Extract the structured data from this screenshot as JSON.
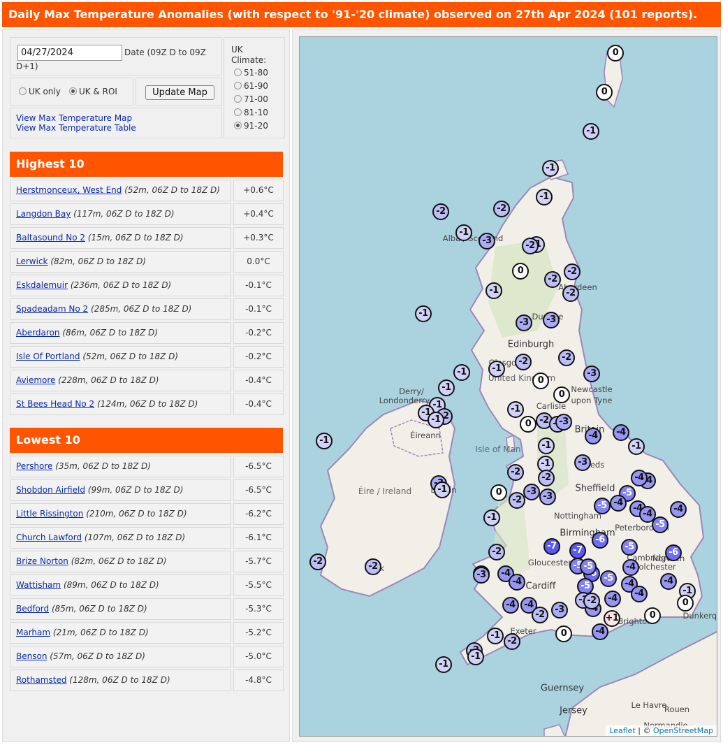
{
  "header": {
    "title": "Daily Max Temperature Anomalies (with respect to '91-'20 climate) observed on 27th Apr 2024 (101 reports)."
  },
  "controls": {
    "date_value": "04/27/2024",
    "date_label_a": "Date (09Z D to 09Z",
    "date_label_b": "D+1)",
    "region_options": [
      {
        "label": "UK only",
        "selected": false
      },
      {
        "label": "UK & ROI",
        "selected": true
      }
    ],
    "update_button": "Update Map",
    "links": [
      "View Max Temperature Map",
      "View Max Temperature Table"
    ],
    "climate_title": "UK Climate:",
    "climate_options": [
      {
        "label": "51-80",
        "selected": false
      },
      {
        "label": "61-90",
        "selected": false
      },
      {
        "label": "71-00",
        "selected": false
      },
      {
        "label": "81-10",
        "selected": false
      },
      {
        "label": "91-20",
        "selected": true
      }
    ]
  },
  "highest": {
    "title": "Highest 10",
    "rows": [
      {
        "station": "Herstmonceux, West End",
        "detail": "(52m, 06Z D to 18Z D)",
        "value": "+0.6°C"
      },
      {
        "station": "Langdon Bay",
        "detail": "(117m, 06Z D to 18Z D)",
        "value": "+0.4°C"
      },
      {
        "station": "Baltasound No 2",
        "detail": "(15m, 06Z D to 18Z D)",
        "value": "+0.3°C"
      },
      {
        "station": "Lerwick",
        "detail": "(82m, 06Z D to 18Z D)",
        "value": "0.0°C"
      },
      {
        "station": "Eskdalemuir",
        "detail": "(236m, 06Z D to 18Z D)",
        "value": "-0.1°C"
      },
      {
        "station": "Spadeadam No 2",
        "detail": "(285m, 06Z D to 18Z D)",
        "value": "-0.1°C"
      },
      {
        "station": "Aberdaron",
        "detail": "(86m, 06Z D to 18Z D)",
        "value": "-0.2°C"
      },
      {
        "station": "Isle Of Portland",
        "detail": "(52m, 06Z D to 18Z D)",
        "value": "-0.2°C"
      },
      {
        "station": "Aviemore",
        "detail": "(228m, 06Z D to 18Z D)",
        "value": "-0.4°C"
      },
      {
        "station": "St Bees Head No 2",
        "detail": "(124m, 06Z D to 18Z D)",
        "value": "-0.4°C"
      }
    ]
  },
  "lowest": {
    "title": "Lowest 10",
    "rows": [
      {
        "station": "Pershore",
        "detail": "(35m, 06Z D to 18Z D)",
        "value": "-6.5°C"
      },
      {
        "station": "Shobdon Airfield",
        "detail": "(99m, 06Z D to 18Z D)",
        "value": "-6.5°C"
      },
      {
        "station": "Little Rissington",
        "detail": "(210m, 06Z D to 18Z D)",
        "value": "-6.2°C"
      },
      {
        "station": "Church Lawford",
        "detail": "(107m, 06Z D to 18Z D)",
        "value": "-6.1°C"
      },
      {
        "station": "Brize Norton",
        "detail": "(82m, 06Z D to 18Z D)",
        "value": "-5.7°C"
      },
      {
        "station": "Wattisham",
        "detail": "(89m, 06Z D to 18Z D)",
        "value": "-5.5°C"
      },
      {
        "station": "Bedford",
        "detail": "(85m, 06Z D to 18Z D)",
        "value": "-5.3°C"
      },
      {
        "station": "Marham",
        "detail": "(21m, 06Z D to 18Z D)",
        "value": "-5.2°C"
      },
      {
        "station": "Benson",
        "detail": "(57m, 06Z D to 18Z D)",
        "value": "-5.0°C"
      },
      {
        "station": "Rothamsted",
        "detail": "(128m, 06Z D to 18Z D)",
        "value": "-4.8°C"
      }
    ]
  },
  "map": {
    "place_labels": [
      {
        "text": "Aberdeen"
      },
      {
        "text": "Dundee"
      },
      {
        "text": "Edinburgh",
        "big": true
      },
      {
        "text": "Glasgow"
      },
      {
        "text": "United Kingdom",
        "country": true
      },
      {
        "text": "Newcastle"
      },
      {
        "text": "upon Tyne"
      },
      {
        "text": "Derry/"
      },
      {
        "text": "Londonderry"
      },
      {
        "text": "Carlisle"
      },
      {
        "text": "Britain",
        "big": true
      },
      {
        "text": "Isle of Man",
        "sea": true
      },
      {
        "text": "Éire / Ireland",
        "country": true
      },
      {
        "text": "Éireann"
      },
      {
        "text": "eds"
      },
      {
        "text": "Sheffield",
        "big": true
      },
      {
        "text": "Nottingham"
      },
      {
        "text": "Birmingham",
        "big": true
      },
      {
        "text": "Peterborough"
      },
      {
        "text": "Norwich"
      },
      {
        "text": "Colchester"
      },
      {
        "text": "Gloucester"
      },
      {
        "text": "Cardiff",
        "big": true
      },
      {
        "text": "Cambridge"
      },
      {
        "text": "Brighton"
      },
      {
        "text": "Dunkerque"
      },
      {
        "text": "Exeter"
      },
      {
        "text": "Guernsey",
        "big": true
      },
      {
        "text": "Jersey",
        "big": true
      },
      {
        "text": "Le Havre"
      },
      {
        "text": "Rouen"
      },
      {
        "text": "Normandie"
      },
      {
        "text": "Alba / Scotland"
      },
      {
        "text": "Dublin"
      },
      {
        "text": "Cork"
      }
    ],
    "markers": [
      {
        "label": "0",
        "anomaly": 0.0
      },
      {
        "label": "0",
        "anomaly": 0.0
      },
      {
        "label": "-1",
        "anomaly": -1
      },
      {
        "label": "-1",
        "anomaly": -1
      },
      {
        "label": "-1",
        "anomaly": -1
      },
      {
        "label": "-2",
        "anomaly": -2
      },
      {
        "label": "-2",
        "anomaly": -2
      },
      {
        "label": "-1",
        "anomaly": -1
      },
      {
        "label": "-3",
        "anomaly": -3
      },
      {
        "label": "-1",
        "anomaly": -1
      },
      {
        "label": "-2",
        "anomaly": -2
      },
      {
        "label": "0",
        "anomaly": 0
      },
      {
        "label": "-2",
        "anomaly": -2
      },
      {
        "label": "-2",
        "anomaly": -2
      },
      {
        "label": "-2",
        "anomaly": -2
      },
      {
        "label": "-1",
        "anomaly": -1
      },
      {
        "label": "-1",
        "anomaly": -1
      },
      {
        "label": "-3",
        "anomaly": -3
      },
      {
        "label": "-3",
        "anomaly": -3
      },
      {
        "label": "-1",
        "anomaly": -1
      },
      {
        "label": "-2",
        "anomaly": -2
      },
      {
        "label": "-2",
        "anomaly": -2
      },
      {
        "label": "-3",
        "anomaly": -3
      },
      {
        "label": "0",
        "anomaly": 0
      },
      {
        "label": "0",
        "anomaly": 0
      },
      {
        "label": "-1",
        "anomaly": -1
      },
      {
        "label": "-1",
        "anomaly": -1
      },
      {
        "label": "-1",
        "anomaly": -1
      },
      {
        "label": "-1",
        "anomaly": -1
      },
      {
        "label": "-2",
        "anomaly": -2
      },
      {
        "label": "-1",
        "anomaly": -1
      },
      {
        "label": "0",
        "anomaly": 0
      },
      {
        "label": "-1",
        "anomaly": -1
      },
      {
        "label": "-2",
        "anomaly": -2
      },
      {
        "label": "-2",
        "anomaly": -2
      },
      {
        "label": "-3",
        "anomaly": -3
      },
      {
        "label": "-4",
        "anomaly": -4
      },
      {
        "label": "-4",
        "anomaly": -4
      },
      {
        "label": "-1",
        "anomaly": -1
      },
      {
        "label": "-1",
        "anomaly": -1
      },
      {
        "label": "-1",
        "anomaly": -1
      },
      {
        "label": "-4",
        "anomaly": -4
      },
      {
        "label": "-1",
        "anomaly": -1
      },
      {
        "label": "-3",
        "anomaly": -3
      },
      {
        "label": "-2",
        "anomaly": -2
      },
      {
        "label": "-3",
        "anomaly": -3
      },
      {
        "label": "-3",
        "anomaly": -3
      },
      {
        "label": "-3",
        "anomaly": -3
      },
      {
        "label": "-1",
        "anomaly": -1
      },
      {
        "label": "0",
        "anomaly": 0
      },
      {
        "label": "-1",
        "anomaly": -1
      },
      {
        "label": "-2",
        "anomaly": -2
      },
      {
        "label": "-2",
        "anomaly": -2
      },
      {
        "label": "-4",
        "anomaly": -4
      },
      {
        "label": "-5",
        "anomaly": -5
      },
      {
        "label": "-4",
        "anomaly": -4
      },
      {
        "label": "-4",
        "anomaly": -4
      },
      {
        "label": "-4",
        "anomaly": -4
      },
      {
        "label": "-5",
        "anomaly": -5
      },
      {
        "label": "-4",
        "anomaly": -4
      },
      {
        "label": "-5",
        "anomaly": -5
      },
      {
        "label": "-7",
        "anomaly": -7
      },
      {
        "label": "-7",
        "anomaly": -7
      },
      {
        "label": "-6",
        "anomaly": -6
      },
      {
        "label": "-5",
        "anomaly": -5
      },
      {
        "label": "-6",
        "anomaly": -6
      },
      {
        "label": "-2",
        "anomaly": -2
      },
      {
        "label": "-3",
        "anomaly": -3
      },
      {
        "label": "-4",
        "anomaly": -4
      },
      {
        "label": "-4",
        "anomaly": -4
      },
      {
        "label": "-5",
        "anomaly": -5
      },
      {
        "label": "-6",
        "anomaly": -6
      },
      {
        "label": "-5",
        "anomaly": -5
      },
      {
        "label": "-5",
        "anomaly": -5
      },
      {
        "label": "-5",
        "anomaly": -5
      },
      {
        "label": "-4",
        "anomaly": -4
      },
      {
        "label": "-4",
        "anomaly": -4
      },
      {
        "label": "-4",
        "anomaly": -4
      },
      {
        "label": "-4",
        "anomaly": -4
      },
      {
        "label": "-4",
        "anomaly": -4
      },
      {
        "label": "-1",
        "anomaly": -1
      },
      {
        "label": "0",
        "anomaly": 0
      },
      {
        "label": "-4",
        "anomaly": -4
      },
      {
        "label": "-4",
        "anomaly": -4
      },
      {
        "label": "-2",
        "anomaly": -2
      },
      {
        "label": "-3",
        "anomaly": -3
      },
      {
        "label": "-4",
        "anomaly": -4
      },
      {
        "label": "-2",
        "anomaly": -2
      },
      {
        "label": "-2",
        "anomaly": -2
      },
      {
        "label": "+1",
        "anomaly": 1
      },
      {
        "label": "0",
        "anomaly": 0
      },
      {
        "label": "0",
        "anomaly": 0
      },
      {
        "label": "-4",
        "anomaly": -4
      },
      {
        "label": "-1",
        "anomaly": -1
      },
      {
        "label": "-2",
        "anomaly": -2
      },
      {
        "label": "-2",
        "anomaly": -2
      },
      {
        "label": "-1",
        "anomaly": -1
      },
      {
        "label": "-1",
        "anomaly": -1
      },
      {
        "label": "-2",
        "anomaly": -2
      },
      {
        "label": "-2",
        "anomaly": -2
      },
      {
        "label": "-3",
        "anomaly": -3
      }
    ],
    "attribution_leaflet": "Leaflet",
    "attribution_sep": " | © ",
    "attribution_osm": "OpenStreetMap",
    "colors": {
      "sea": "#aad3df",
      "land": "#f2efe9",
      "border": "#9e86b8",
      "positive": "#ffe5e5",
      "zero": "#ffffff"
    }
  }
}
